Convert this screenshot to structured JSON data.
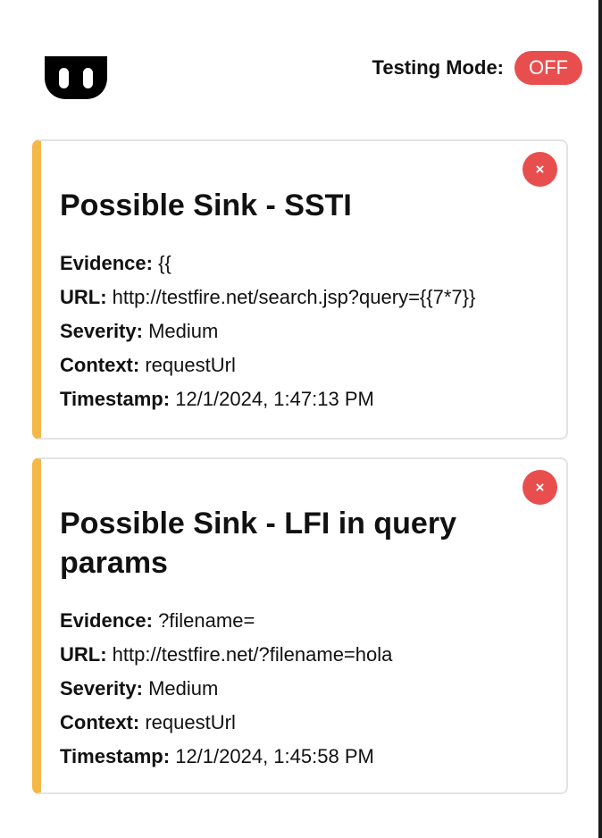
{
  "header": {
    "logo_icon": "bw-logo-icon",
    "testing_mode_label": "Testing Mode:",
    "testing_mode_value": "OFF"
  },
  "labels": {
    "evidence": "Evidence:",
    "url": "URL:",
    "severity": "Severity:",
    "context": "Context:",
    "timestamp": "Timestamp:"
  },
  "findings": [
    {
      "close_label": "×",
      "title": "Possible Sink - SSTI",
      "evidence": "{{",
      "url": "http://testfire.net/search.jsp?query={{7*7}}",
      "severity": "Medium",
      "context": "requestUrl",
      "timestamp": "12/1/2024, 1:47:13 PM"
    },
    {
      "close_label": "×",
      "title": "Possible Sink - LFI in query params",
      "evidence": "?filename=",
      "url": "http://testfire.net/?filename=hola",
      "severity": "Medium",
      "context": "requestUrl",
      "timestamp": "12/1/2024, 1:45:58 PM"
    }
  ],
  "colors": {
    "accent_bar": "#f3b847",
    "danger": "#e94e4e",
    "card_border": "#e3e3e3"
  }
}
